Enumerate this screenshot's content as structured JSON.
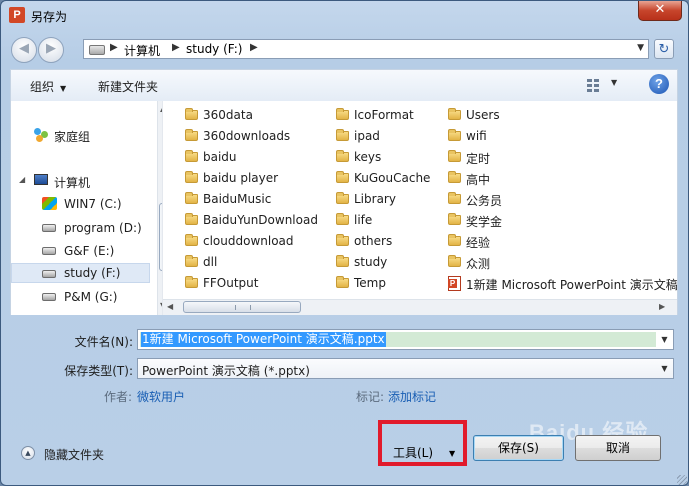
{
  "window": {
    "title": "另存为",
    "app_icon_letter": "P",
    "close_glyph": "✕"
  },
  "nav": {
    "back_glyph": "◀",
    "forward_glyph": "▶",
    "breadcrumb": [
      "计算机",
      "study (F:)"
    ],
    "refresh_glyph": "↻"
  },
  "toolbar": {
    "organize": "组织",
    "new_folder": "新建文件夹",
    "help": "?"
  },
  "sidebar": {
    "items": [
      {
        "label": "家庭组",
        "icon": "homegroup-icon"
      },
      {
        "label": "计算机",
        "icon": "computer-icon"
      },
      {
        "label": "WIN7 (C:)",
        "icon": "windows-drive-icon"
      },
      {
        "label": "program (D:)",
        "icon": "drive-icon"
      },
      {
        "label": "G&F (E:)",
        "icon": "drive-icon"
      },
      {
        "label": "study (F:)",
        "icon": "drive-icon",
        "selected": true
      },
      {
        "label": "P&M (G:)",
        "icon": "drive-icon"
      }
    ]
  },
  "files": {
    "column1": [
      "360data",
      "360downloads",
      "baidu",
      "baidu player",
      "BaiduMusic",
      "BaiduYunDownload",
      "clouddownload",
      "dll",
      "FFOutput"
    ],
    "column2": [
      "IcoFormat",
      "ipad",
      "keys",
      "KuGouCache",
      "Library",
      "life",
      "others",
      "study",
      "Temp"
    ],
    "column3": [
      "Users",
      "wifi",
      "定时",
      "高中",
      "公务员",
      "奖学金",
      "经验",
      "众测",
      "1新建 Microsoft PowerPoint 演示文稿."
    ]
  },
  "form": {
    "filename_label": "文件名(N):",
    "filename_value": "1新建 Microsoft PowerPoint 演示文稿.pptx",
    "filetype_label": "保存类型(T):",
    "filetype_value": "PowerPoint 演示文稿 (*.pptx)",
    "author_label": "作者:",
    "author_value": "微软用户",
    "tags_label": "标记:",
    "tags_value": "添加标记"
  },
  "footer": {
    "hide_folders": "隐藏文件夹",
    "tools": "工具(L)",
    "save": "保存(S)",
    "cancel": "取消",
    "watermark": "Baidu 经验"
  },
  "colors": {
    "highlight_box": "#e11a2b",
    "selection": "#3399ff",
    "link": "#1a5fb4"
  }
}
